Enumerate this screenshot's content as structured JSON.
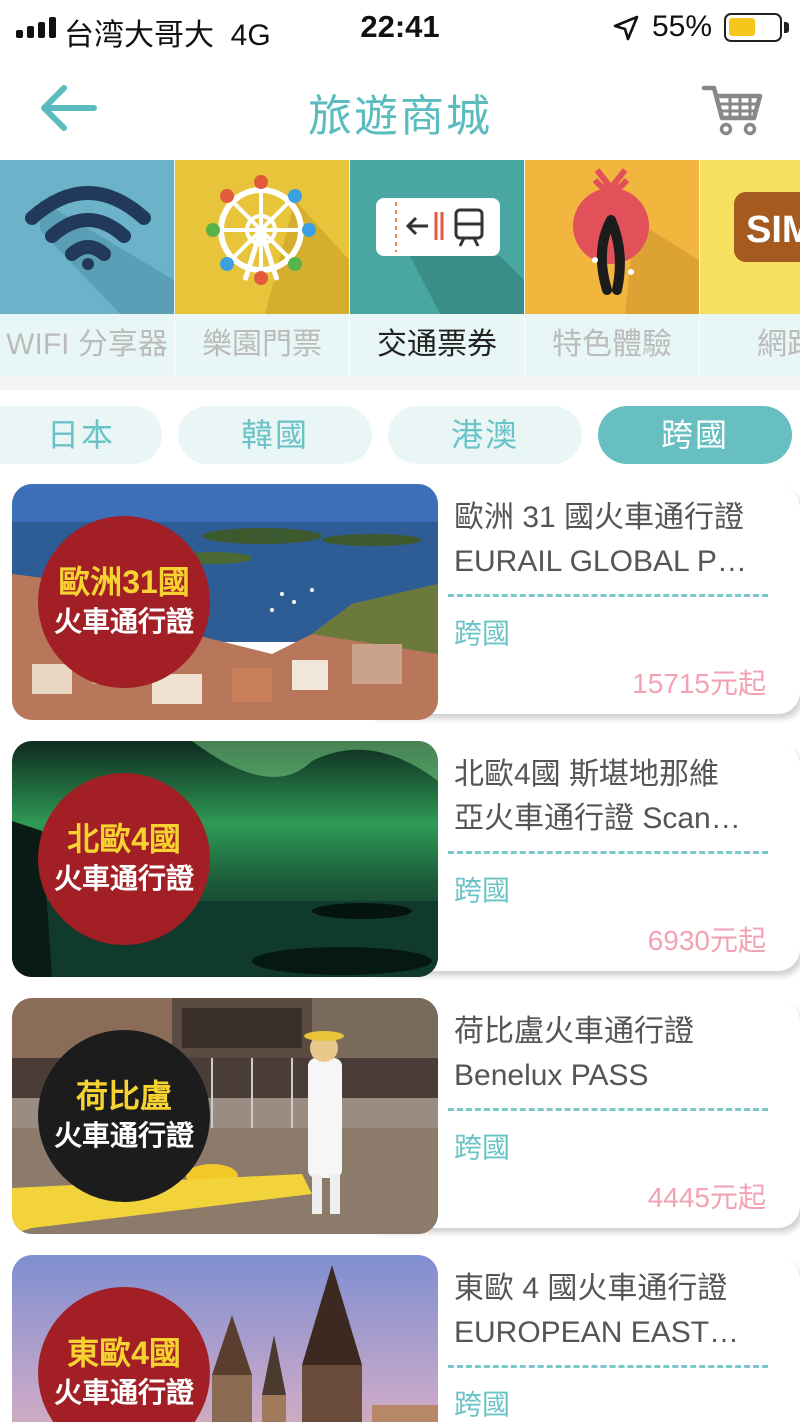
{
  "status_bar": {
    "carrier": "台湾大哥大",
    "network": "4G",
    "time": "22:41",
    "battery_percent": "55%",
    "battery_level": 0.55
  },
  "nav": {
    "title": "旅遊商城",
    "back_icon": "arrow-left-icon",
    "cart_icon": "shopping-cart-icon"
  },
  "categories": [
    {
      "label": "WIFI 分享器",
      "icon": "wifi-icon",
      "color": "#6cb3c9",
      "active": false
    },
    {
      "label": "樂園門票",
      "icon": "ferris-wheel-icon",
      "color": "#e8c43a",
      "active": false
    },
    {
      "label": "交通票券",
      "icon": "train-ticket-icon",
      "color": "#4aa6a0",
      "active": true
    },
    {
      "label": "特色體驗",
      "icon": "gift-icon",
      "color": "#f2b63f",
      "active": false
    },
    {
      "label": "網路",
      "icon": "sim-card-icon",
      "color": "#f7e060",
      "active": false
    }
  ],
  "regions": [
    {
      "label": "日本",
      "active": false
    },
    {
      "label": "韓國",
      "active": false
    },
    {
      "label": "港澳",
      "active": false
    },
    {
      "label": "跨國",
      "active": true
    }
  ],
  "products": [
    {
      "badge_line1": "歐洲31國",
      "badge_line2": "火車通行證",
      "title_line1": "歐洲 31 國火車通行證",
      "title_line2": "EURAIL GLOBAL P…",
      "tag": "跨國",
      "price": "15715元起"
    },
    {
      "badge_line1": "北歐4國",
      "badge_line2": "火車通行證",
      "title_line1": "北歐4國 斯堪地那維",
      "title_line2": "亞火車通行證  Scan…",
      "tag": "跨國",
      "price": "6930元起"
    },
    {
      "badge_line1": "荷比盧",
      "badge_line2": "火車通行證",
      "title_line1": "荷比盧火車通行證",
      "title_line2": "Benelux PASS",
      "tag": "跨國",
      "price": "4445元起"
    },
    {
      "badge_line1": "東歐4國",
      "badge_line2": "火車通行證",
      "title_line1": "東歐 4 國火車通行證",
      "title_line2": "EUROPEAN EAST…",
      "tag": "跨國",
      "price": ""
    }
  ],
  "colors": {
    "accent": "#5bbcbf",
    "price": "#f3a2b4",
    "badge_red": "#a21f26",
    "badge_yellow": "#f6d330"
  }
}
